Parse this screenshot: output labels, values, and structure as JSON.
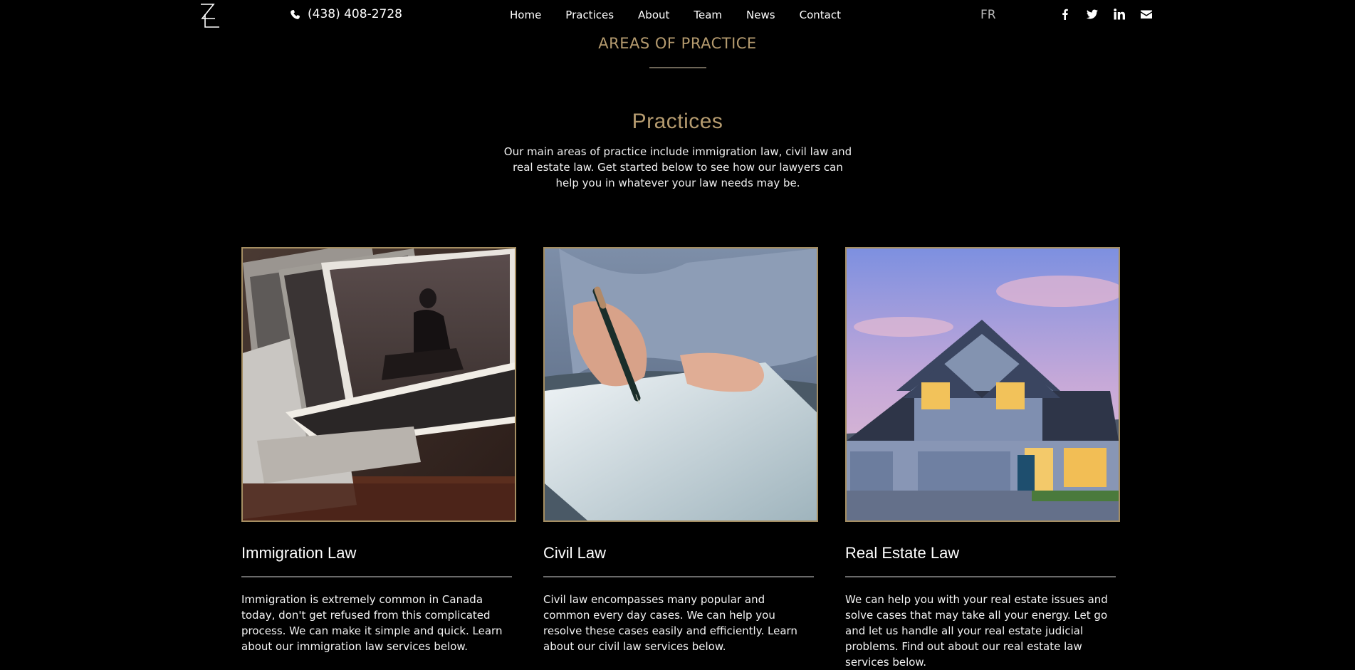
{
  "header": {
    "phone": "(438) 408-2728",
    "nav": [
      "Home",
      "Practices",
      "About",
      "Team",
      "News",
      "Contact"
    ],
    "lang": "FR",
    "social_icons": [
      "facebook-icon",
      "twitter-icon",
      "linkedin-icon",
      "envelope-icon"
    ]
  },
  "section": {
    "label": "AREAS OF PRACTICE",
    "title": "Practices",
    "intro": "Our main areas of practice include immigration law, civil law and real estate law. Get started below to see how our lawyers can help you in whatever your law needs may be."
  },
  "cards": [
    {
      "title": "Immigration Law",
      "text": "Immigration is extremely common in Canada today, don't get refused from this complicated process. We can make it simple and quick. Learn about our immigration law services below."
    },
    {
      "title": "Civil Law",
      "text": "Civil law encompasses many popular and common every day cases. We can help you resolve these cases easily and efficiently. Learn about our civil law services below."
    },
    {
      "title": "Real Estate Law",
      "text": "We can help you with your real estate issues and solve cases that may take all your energy. Let go and let us handle all your real estate judicial problems. Find out about our real estate law services below."
    }
  ],
  "colors": {
    "accent": "#b59b6f",
    "frame": "#a58e62",
    "background": "#000000"
  }
}
